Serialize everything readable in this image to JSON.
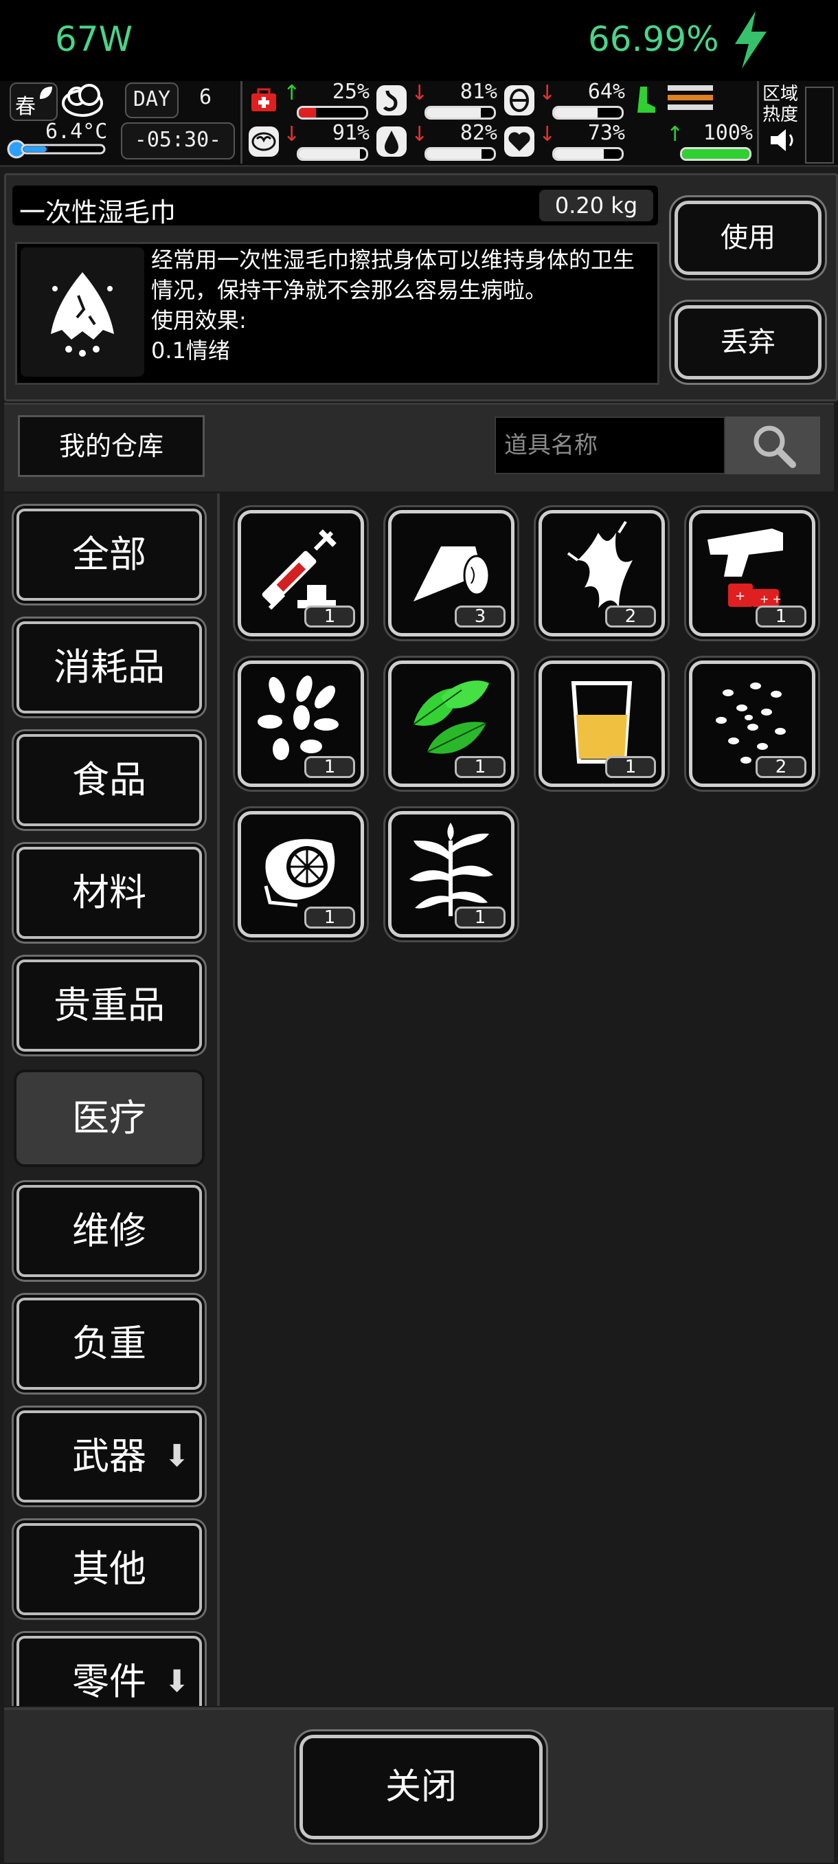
{
  "status_bar": {
    "left": "67W",
    "right": "66.99%"
  },
  "hud": {
    "season": "春",
    "day_label": "DAY",
    "day_number": "6",
    "temperature": "6.4°C",
    "time": "-05:30-",
    "stats": [
      {
        "icon": "medkit-icon",
        "direction": "up",
        "value": "25%",
        "fill_fraction": 0.25,
        "fill_color": "#e02020"
      },
      {
        "icon": "stomach-icon",
        "direction": "down",
        "value": "81%",
        "fill_fraction": 0.81,
        "fill_color": "#eeeeee"
      },
      {
        "icon": "bladder-icon",
        "direction": "down",
        "value": "64%",
        "fill_fraction": 0.64,
        "fill_color": "#eeeeee"
      },
      {
        "icon": "stamina-icon",
        "direction": "none",
        "value": "",
        "fill_fraction": 1.0,
        "fill_color": "#e0a020"
      },
      {
        "icon": "brain-icon",
        "direction": "down",
        "value": "91%",
        "fill_fraction": 0.91,
        "fill_color": "#eeeeee"
      },
      {
        "icon": "water-drop-icon",
        "direction": "down",
        "value": "82%",
        "fill_fraction": 0.82,
        "fill_color": "#eeeeee"
      },
      {
        "icon": "heart-icon",
        "direction": "down",
        "value": "73%",
        "fill_fraction": 0.73,
        "fill_color": "#eeeeee"
      },
      {
        "icon": "battery-icon",
        "direction": "up",
        "value": "100%",
        "fill_fraction": 1.0,
        "fill_color": "#30d030"
      }
    ],
    "zone_heat_label": "区域\n热度"
  },
  "detail": {
    "item_name": "一次性湿毛巾",
    "weight": "0.20 kg",
    "description": "经常用一次性湿毛巾擦拭身体可以维持身体的卫生情况，保持干净就不会那么容易生病啦。\n使用效果:\n0.1情绪",
    "use_label": "使用",
    "drop_label": "丢弃"
  },
  "warehouse": {
    "title": "我的仓库",
    "search_placeholder": "道具名称"
  },
  "categories": [
    {
      "label": "全部",
      "active": false,
      "has_arrow": false
    },
    {
      "label": "消耗品",
      "active": false,
      "has_arrow": false
    },
    {
      "label": "食品",
      "active": false,
      "has_arrow": false
    },
    {
      "label": "材料",
      "active": false,
      "has_arrow": false
    },
    {
      "label": "贵重品",
      "active": false,
      "has_arrow": false
    },
    {
      "label": "医疗",
      "active": true,
      "has_arrow": false
    },
    {
      "label": "维修",
      "active": false,
      "has_arrow": false
    },
    {
      "label": "负重",
      "active": false,
      "has_arrow": false
    },
    {
      "label": "武器",
      "active": false,
      "has_arrow": true
    },
    {
      "label": "其他",
      "active": false,
      "has_arrow": false
    },
    {
      "label": "零件",
      "active": false,
      "has_arrow": true
    }
  ],
  "items": [
    {
      "icon": "syringe-icon",
      "count": "1"
    },
    {
      "icon": "bandage-roll-icon",
      "count": "3"
    },
    {
      "icon": "ginseng-root-icon",
      "count": "2"
    },
    {
      "icon": "flare-gun-icon",
      "count": "1"
    },
    {
      "icon": "seeds-leaves-icon",
      "count": "1"
    },
    {
      "icon": "green-herb-icon",
      "count": "1"
    },
    {
      "icon": "medicine-cup-icon",
      "count": "1"
    },
    {
      "icon": "pills-scatter-icon",
      "count": "2"
    },
    {
      "icon": "gas-mask-icon",
      "count": "1"
    },
    {
      "icon": "dry-herb-plant-icon",
      "count": "1"
    }
  ],
  "close_label": "关闭"
}
